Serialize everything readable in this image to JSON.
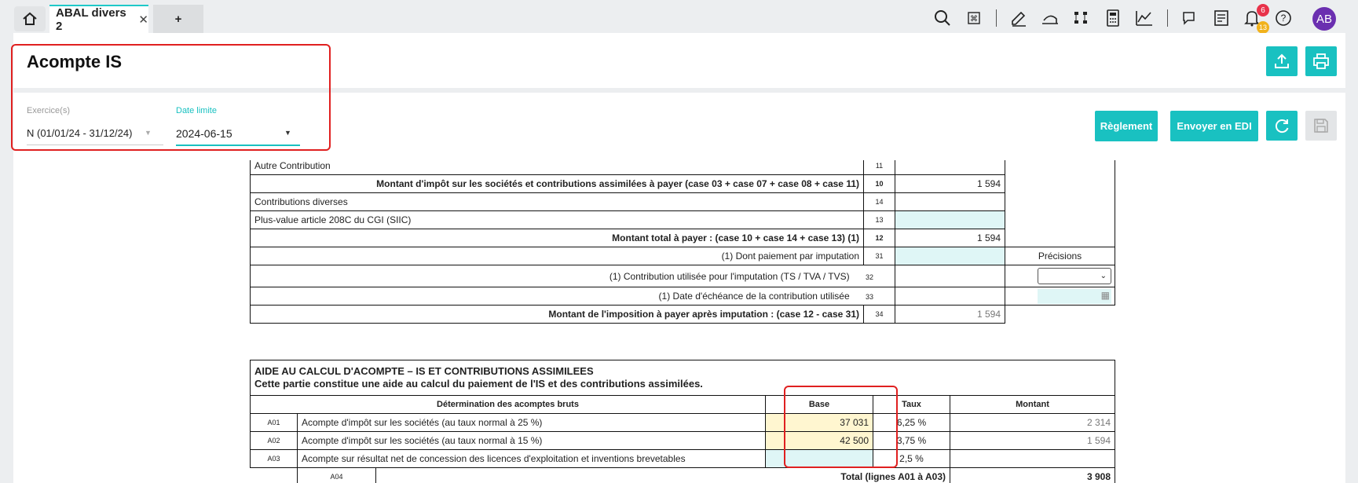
{
  "tabs": {
    "active": "ABAL divers 2",
    "add": "+"
  },
  "notifications": {
    "count_red": "6",
    "count_yellow": "13"
  },
  "user": {
    "initials": "AB"
  },
  "colors": {
    "accent": "#19c1c1",
    "avatar": "#6b2fb0",
    "highlight": "#e02020"
  },
  "page": {
    "title": "Acompte IS"
  },
  "filters": {
    "exercice_label": "Exercice(s)",
    "exercice_value": "N  (01/01/24 - 31/12/24)",
    "date_label": "Date limite",
    "date_value": "2024-06-15"
  },
  "actions": {
    "reglement": "Règlement",
    "edi": "Envoyer en EDI"
  },
  "top_table": {
    "rows": [
      {
        "label": "Autre Contribution",
        "num": "11",
        "value": ""
      },
      {
        "label": "Montant d'impôt sur les sociétés et contributions assimilées à payer (case 03 + case 07 + case 08 + case 11)",
        "num": "10",
        "value": "1 594"
      },
      {
        "label": "Contributions diverses",
        "num": "14",
        "value": ""
      },
      {
        "label": "Plus-value article 208C du CGI (SIIC)",
        "num": "13",
        "value": ""
      },
      {
        "label": "Montant total à payer : (case 10 + case 14 + case 13) (1)",
        "num": "12",
        "value": "1 594"
      },
      {
        "label": "(1) Dont paiement par imputation",
        "num": "31",
        "value": ""
      },
      {
        "label": "(1) Contribution utilisée pour l'imputation (TS / TVA / TVS)",
        "num": "32",
        "value": ""
      },
      {
        "label": "(1) Date d'échéance de la contribution utilisée",
        "num": "33",
        "value": ""
      },
      {
        "label": "Montant de l'imposition à payer après imputation : (case 12 - case 31)",
        "num": "34",
        "value": "1 594"
      }
    ],
    "precisions": "Précisions"
  },
  "aide": {
    "title": "AIDE AU CALCUL D'ACOMPTE – IS ET CONTRIBUTIONS ASSIMILEES",
    "subtitle": "Cette partie constitue une aide au calcul du paiement de l'IS et des contributions assimilées.",
    "headers": {
      "det": "Détermination des acomptes bruts",
      "base": "Base",
      "taux": "Taux",
      "montant": "Montant"
    },
    "rows": [
      {
        "code": "A01",
        "label": "Acompte d'impôt sur les sociétés (au taux normal à 25 %)",
        "base": "37 031",
        "taux": "6,25 %",
        "montant": "2 314"
      },
      {
        "code": "A02",
        "label": "Acompte d'impôt sur les sociétés (au taux normal à 15 %)",
        "base": "42 500",
        "taux": "3,75 %",
        "montant": "1 594"
      },
      {
        "code": "A03",
        "label": "Acompte sur résultat net de concession des licences d'exploitation et inventions brevetables",
        "base": "",
        "taux": "2,5 %",
        "montant": ""
      }
    ],
    "total": {
      "code": "A04",
      "label": "Total (lignes A01 à A03)",
      "value": "3 908"
    }
  }
}
